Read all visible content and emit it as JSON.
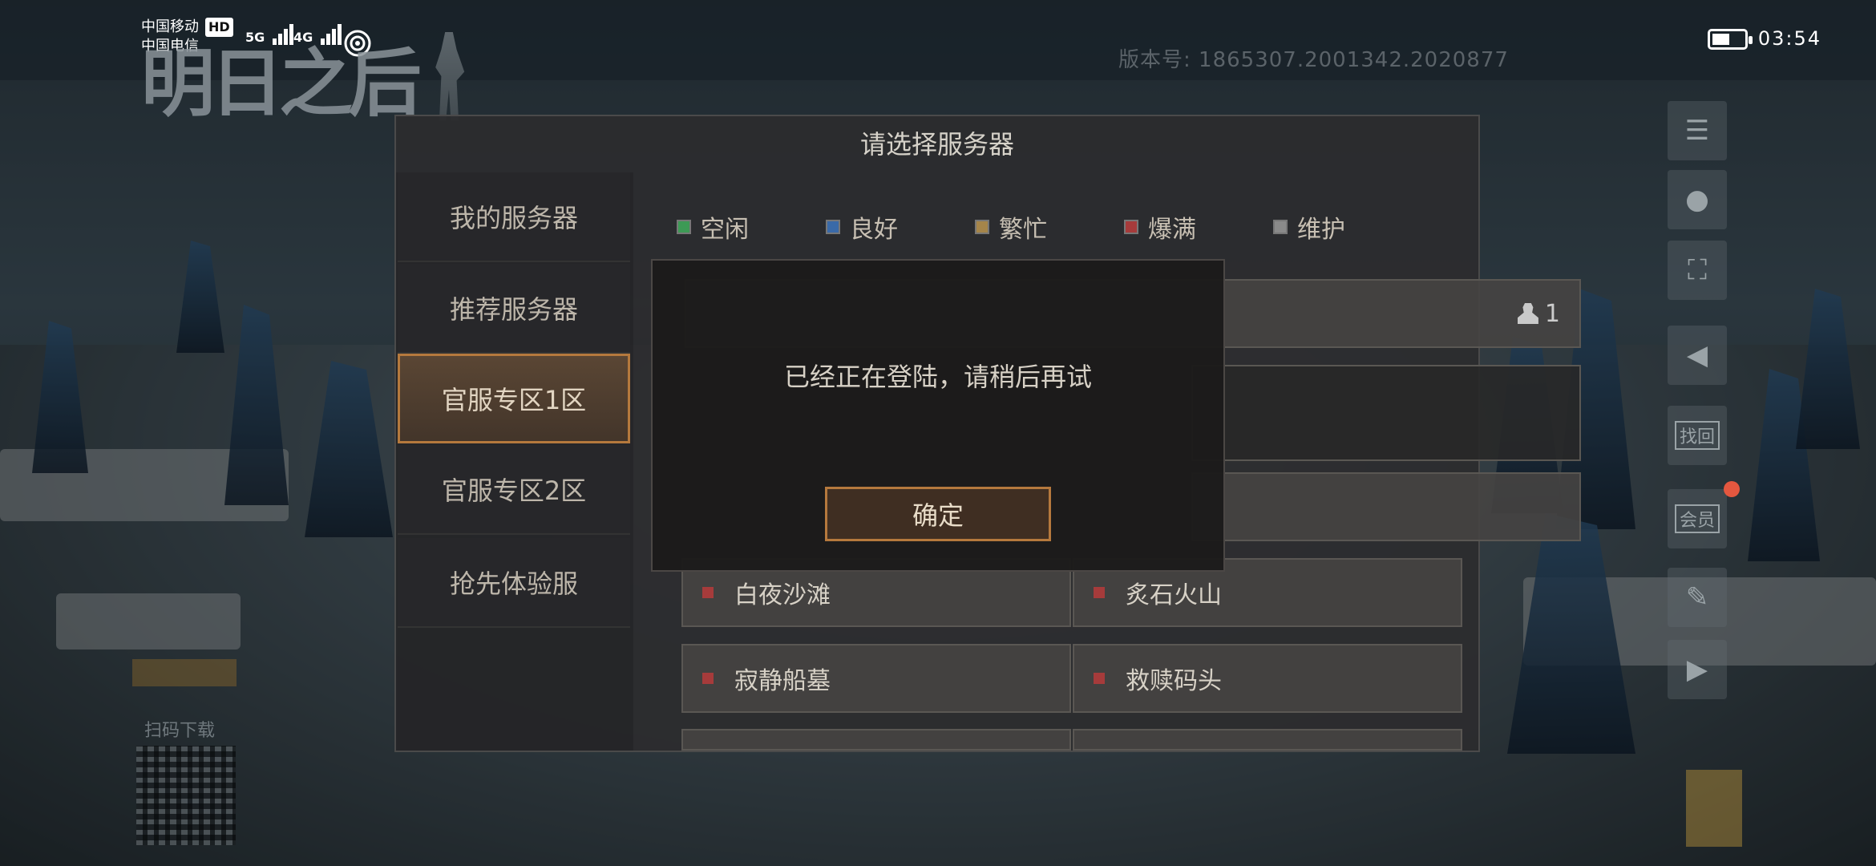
{
  "status_bar": {
    "carrier1": "中国移动",
    "carrier2": "中国电信",
    "hd": "HD",
    "net1": "5G",
    "net2": "4G",
    "time": "03:54",
    "battery_level": 0.55
  },
  "game": {
    "logo": "明日之后",
    "version": "版本号: 1865307.2001342.2020877"
  },
  "qr_label": "扫码下载",
  "side_icons": [
    "news-icon",
    "avatar-icon",
    "scan-icon",
    "speaker-icon",
    "recover-icon",
    "member-icon",
    "edit-icon",
    "video-icon"
  ],
  "side_labels": {
    "recover": "找回",
    "member": "会员"
  },
  "panel": {
    "title": "请选择服务器",
    "tabs": [
      "我的服务器",
      "推荐服务器",
      "官服专区1区",
      "官服专区2区",
      "抢先体验服"
    ],
    "active_tab": 2,
    "legend": [
      {
        "label": "空闲",
        "color": "#3d9a55"
      },
      {
        "label": "良好",
        "color": "#3a6aa8"
      },
      {
        "label": "繁忙",
        "color": "#a5854a"
      },
      {
        "label": "爆满",
        "color": "#a63b3b"
      },
      {
        "label": "维护",
        "color": "#8a8a8a"
      }
    ],
    "top_count": "1",
    "servers": [
      {
        "name": "白夜沙滩",
        "status_color": "#a63b3b"
      },
      {
        "name": "炙石火山",
        "status_color": "#a63b3b"
      },
      {
        "name": "寂静船墓",
        "status_color": "#a63b3b"
      },
      {
        "name": "救赎码头",
        "status_color": "#a63b3b"
      }
    ]
  },
  "dialog": {
    "message": "已经正在登陆，请稍后再试",
    "confirm": "确定"
  }
}
